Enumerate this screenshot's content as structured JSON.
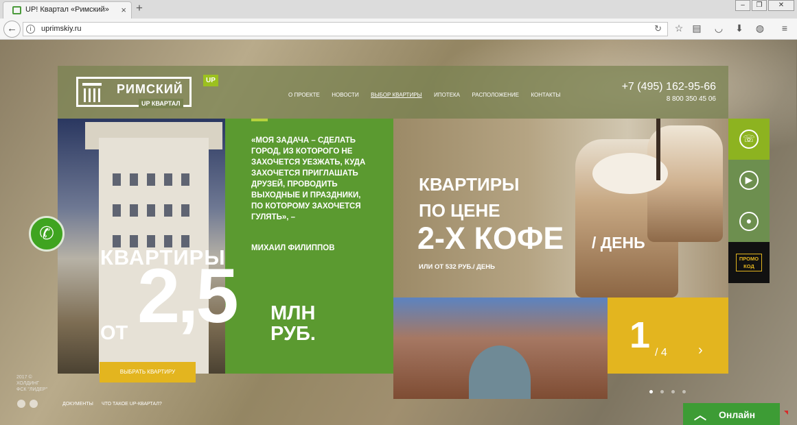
{
  "browser": {
    "tab_title": "UP! Квартал «Римский»",
    "tab_close": "×",
    "new_tab": "+",
    "url": "uprimskiy.ru",
    "win_min": "–",
    "win_max": "❐",
    "win_close": "✕"
  },
  "header": {
    "logo_name": "РИМСКИЙ",
    "logo_sub": "UP КВАРТАЛ",
    "logo_badge": "UP",
    "menu": [
      "О ПРОЕКТЕ",
      "НОВОСТИ",
      "ВЫБОР КВАРТИРЫ",
      "ИПОТЕКА",
      "РАСПОЛОЖЕНИЕ",
      "КОНТАКТЫ"
    ],
    "phone_main": "+7 (495) 162-95-66",
    "phone_alt": "8 800 350 45 06"
  },
  "quote": {
    "text": "«Моя задача – сделать город, из которого не захочется уезжать, куда захочется приглашать друзей, проводить выходные и праздники, по которому захочется гулять», –",
    "author": "МИХАИЛ ФИЛИППОВ"
  },
  "promo_main": {
    "line1": "КВАРТИРЫ",
    "prefix": "ОТ",
    "number": "2,5",
    "unit": "МЛН РУБ.",
    "cta": "ВЫБРАТЬ КВАРТИРУ"
  },
  "promo_coffee": {
    "line1": "КВАРТИРЫ",
    "line2": "ПО ЦЕНЕ",
    "line3": "2-Х КОФЕ",
    "line3b": "/ ДЕНЬ",
    "line4": "ИЛИ ОТ 532 РУБ./ ДЕНЬ"
  },
  "slider": {
    "current": "1",
    "total": "/ 4",
    "next": "›"
  },
  "side_panel": {
    "promo_label": "ПРОМО КОД"
  },
  "footer": {
    "copyright": "2017 © ХОЛДИНГ ФСК \"ЛИДЕР\"",
    "docs": "ДОКУМЕНТЫ",
    "what_is": "ЧТО ТАКОЕ UP-КВАРТАЛ?"
  },
  "chat": {
    "label": "Онлайн",
    "chevron": "︿"
  },
  "colors": {
    "green": "#5b9a30",
    "yellow": "#e3b51f",
    "lime": "#9cc11f",
    "online_green": "#3d9c35"
  }
}
